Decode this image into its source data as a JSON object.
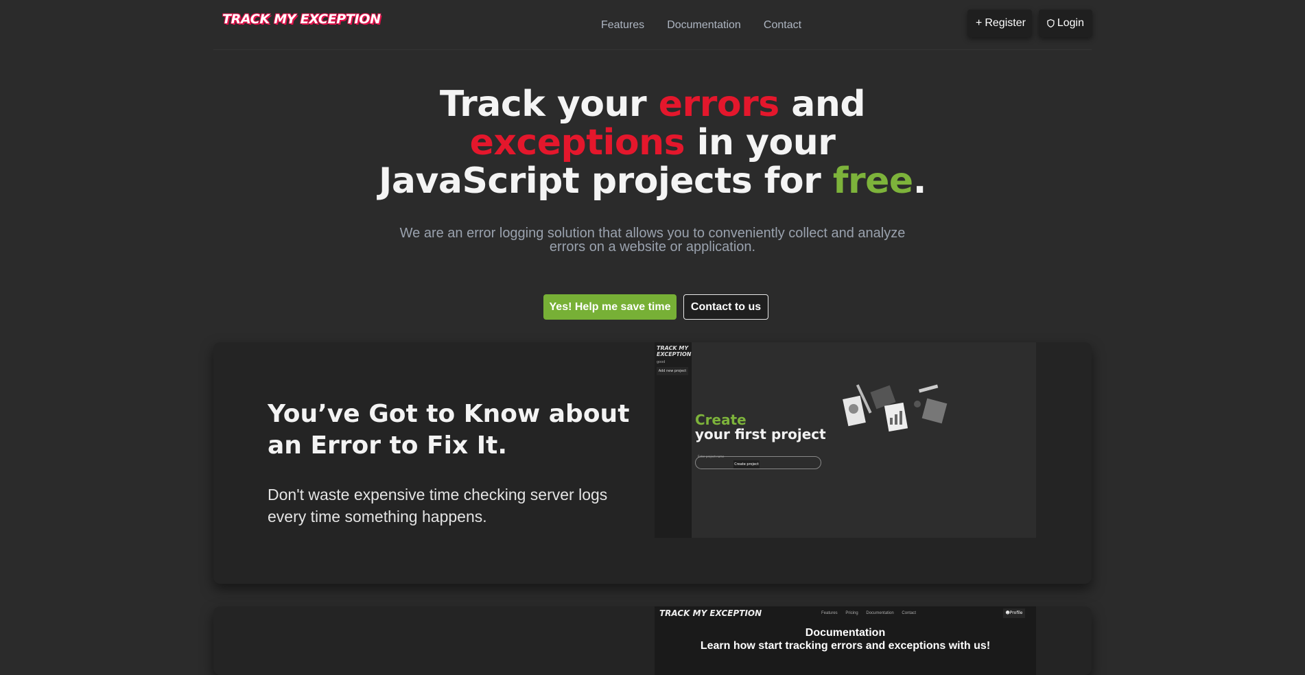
{
  "header": {
    "logo": "TRACK MY EXCEPTION",
    "nav": [
      "Features",
      "Documentation",
      "Contact"
    ],
    "register_label": "Register",
    "login_label": "Login"
  },
  "hero": {
    "title_parts": {
      "p1": "Track your ",
      "p2": "errors",
      "p3": " and",
      "p4": "exceptions",
      "p5": " in your",
      "p6": "JavaScript projects for ",
      "p7": "free",
      "p8": "."
    },
    "subtitle": "We are an error logging solution that allows you to conveniently collect and analyze errors on a website or application.",
    "cta_primary": "Yes! Help me save time",
    "cta_secondary": "Contact to us"
  },
  "feature1": {
    "title": "You’ve Got to Know about an Error to Fix It.",
    "desc": "Don't waste expensive time checking server logs every time something happens.",
    "screenshot": {
      "logo": "TRACK MY EXCEPTION",
      "side_item": "good",
      "add_button": "Add new project",
      "create_word": "Create",
      "create_rest": "your first project",
      "input_placeholder": "Enter project name",
      "create_button": "Create project"
    }
  },
  "feature2": {
    "screenshot": {
      "logo": "TRACK MY EXCEPTION",
      "nav": [
        "Features",
        "Pricing",
        "Documentation",
        "Contact"
      ],
      "profile": "Profile",
      "title": "Documentation",
      "subtitle": "Learn how start tracking errors and exceptions with us!"
    }
  },
  "colors": {
    "accent_red": "#e4172c",
    "accent_green": "#7db33b",
    "background": "#2b2b2b"
  }
}
